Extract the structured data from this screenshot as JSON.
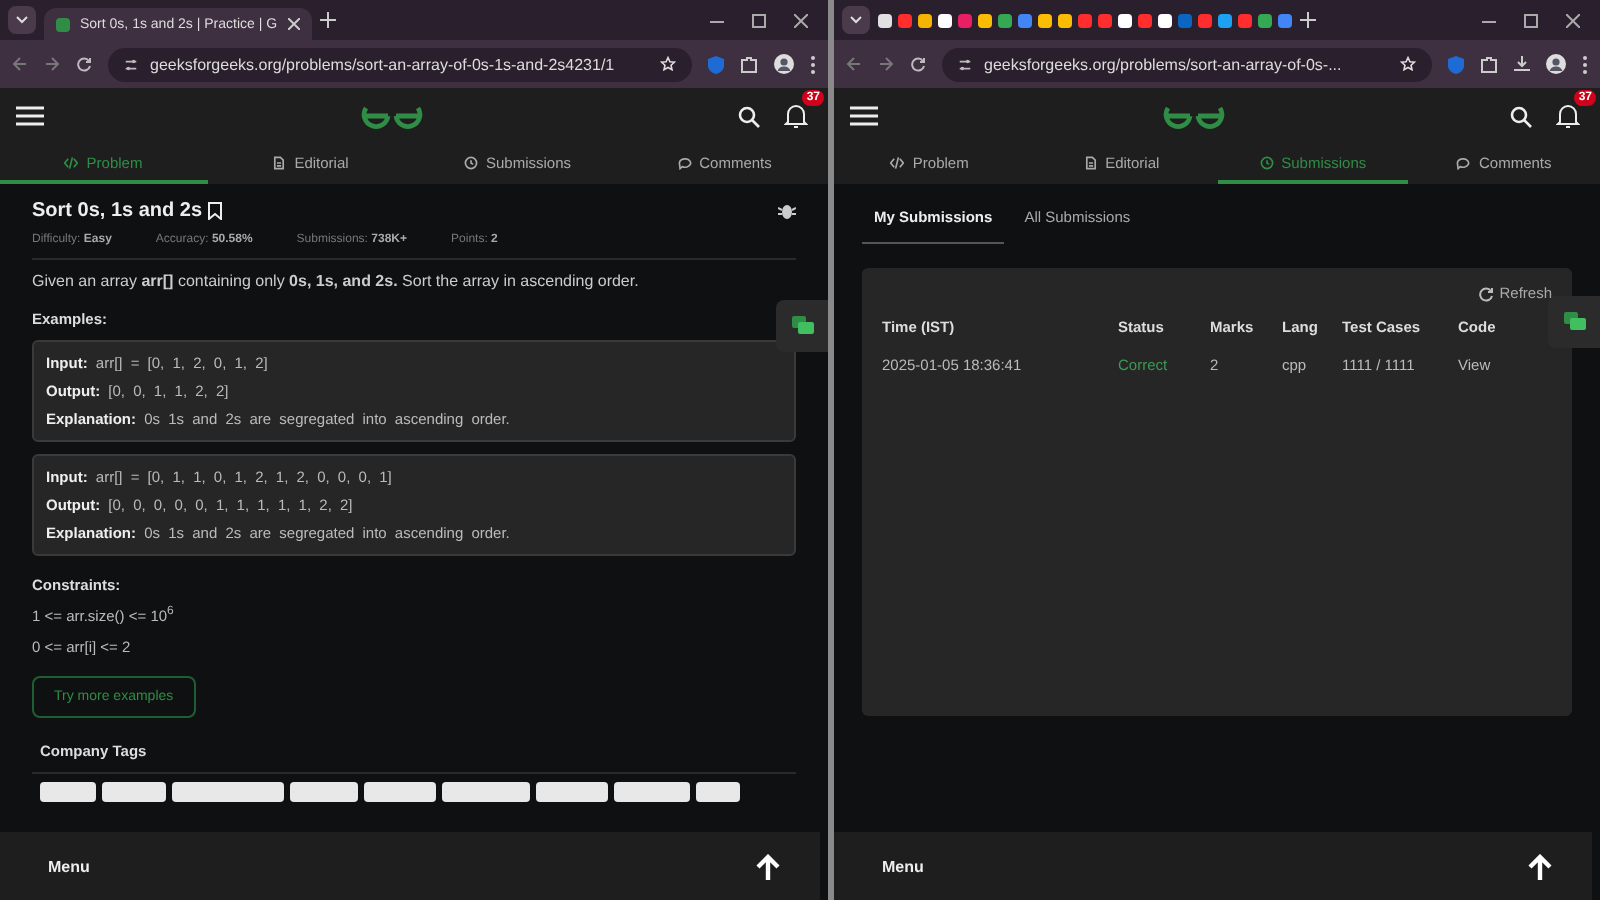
{
  "windows": [
    {
      "kind": "problem",
      "tab_title": "Sort 0s, 1s and 2s | Practice | G",
      "url": "geeksforgeeks.org/problems/sort-an-array-of-0s-1s-and-2s4231/1",
      "notification_count": "37",
      "nav_tabs": [
        {
          "label": "Problem",
          "selected": true
        },
        {
          "label": "Editorial",
          "selected": false
        },
        {
          "label": "Submissions",
          "selected": false
        },
        {
          "label": "Comments",
          "selected": false
        }
      ],
      "problem": {
        "title": "Sort 0s, 1s and 2s",
        "meta": [
          {
            "label": "Difficulty:",
            "value": "Easy"
          },
          {
            "label": "Accuracy:",
            "value": "50.58%"
          },
          {
            "label": "Submissions:",
            "value": "738K+"
          },
          {
            "label": "Points:",
            "value": "2"
          }
        ],
        "statement": "Given an array **arr[]** containing only **0s, 1s, and 2s.** Sort the array in ascending order.",
        "examples_heading": "Examples:",
        "examples": [
          {
            "lines": [
              {
                "label": "Input:",
                "value": "arr[] = [0, 1, 2, 0, 1, 2]"
              },
              {
                "label": "Output:",
                "value": "[0, 0, 1, 1, 2, 2]"
              },
              {
                "label": "Explanation:",
                "value": "0s 1s and 2s are segregated into ascending order."
              }
            ]
          },
          {
            "lines": [
              {
                "label": "Input:",
                "value": "arr[] = [0, 1, 1, 0, 1, 2, 1, 2, 0, 0, 0, 1]"
              },
              {
                "label": "Output:",
                "value": "[0, 0, 0, 0, 0, 1, 1, 1, 1, 1, 2, 2]"
              },
              {
                "label": "Explanation:",
                "value": "0s 1s and 2s are segregated into ascending order."
              }
            ]
          }
        ],
        "constraints_heading": "Constraints:",
        "constraints": [
          "1 <= arr.size() <= 10$^{6}$",
          "0 <= arr[i] <= 2"
        ],
        "more_button": "Try more examples",
        "company_tags_heading": "Company Tags"
      },
      "footer": "Menu"
    },
    {
      "kind": "submissions",
      "url": "geeksforgeeks.org/problems/sort-an-array-of-0s-...",
      "notification_count": "37",
      "nav_tabs": [
        {
          "label": "Problem",
          "selected": false
        },
        {
          "label": "Editorial",
          "selected": false
        },
        {
          "label": "Submissions",
          "selected": true
        },
        {
          "label": "Comments",
          "selected": false
        }
      ],
      "submissions": {
        "subtabs": [
          {
            "label": "My Submissions",
            "selected": true
          },
          {
            "label": "All Submissions",
            "selected": false
          }
        ],
        "refresh": "Refresh",
        "columns": [
          "Time (IST)",
          "Status",
          "Marks",
          "Lang",
          "Test Cases",
          "Code"
        ],
        "rows": [
          {
            "time": "2025-01-05 18:36:41",
            "status": "Correct",
            "passed": true,
            "marks": "2",
            "lang": "cpp",
            "test_cases": "1111 / 1111",
            "code": "View"
          }
        ]
      },
      "footer": "Menu"
    }
  ]
}
